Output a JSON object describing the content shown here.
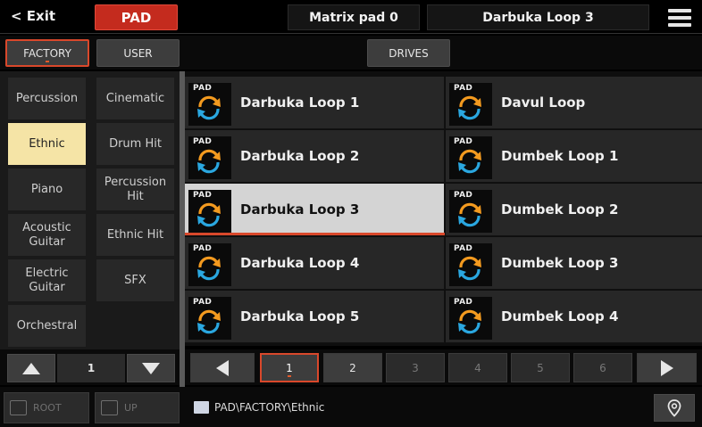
{
  "topbar": {
    "exit_label": "< Exit",
    "mode_label": "PAD",
    "matrix_label": "Matrix pad 0",
    "current_sound": "Darbuka Loop 3",
    "menu_icon": "list-menu-icon"
  },
  "source_tabs": {
    "factory": "FACTORY",
    "user": "USER",
    "drives": "DRIVES"
  },
  "categories": {
    "left": [
      "Percussion",
      "Ethnic",
      "Piano",
      "Acoustic Guitar",
      "Electric Guitar",
      "Orchestral"
    ],
    "right": [
      "Cinematic",
      "Drum Hit",
      "Percussion Hit",
      "Ethnic Hit",
      "SFX",
      ""
    ],
    "selected": "Ethnic"
  },
  "pads": {
    "tag": "PAD",
    "left": [
      "Darbuka Loop 1",
      "Darbuka Loop 2",
      "Darbuka Loop 3",
      "Darbuka Loop 4",
      "Darbuka Loop 5"
    ],
    "right": [
      "Davul Loop",
      "Dumbek Loop 1",
      "Dumbek Loop 2",
      "Dumbek Loop 3",
      "Dumbek Loop 4"
    ],
    "selected": "Darbuka Loop 3"
  },
  "pager": {
    "pages": [
      "1",
      "2",
      "3",
      "4",
      "5",
      "6"
    ],
    "current": "1"
  },
  "category_scroll": {
    "page": "1"
  },
  "bottom": {
    "root_label": "ROOT",
    "up_label": "UP",
    "path": "PAD\\FACTORY\\Ethnic",
    "pin_icon": "location-pin-icon"
  },
  "colors": {
    "accent": "#c42b1e",
    "selected_category": "#f5e4a6",
    "selected_pad": "#d4d4d4",
    "loop_icon_orange": "#f39a1f",
    "loop_icon_blue": "#2aa7e0"
  }
}
